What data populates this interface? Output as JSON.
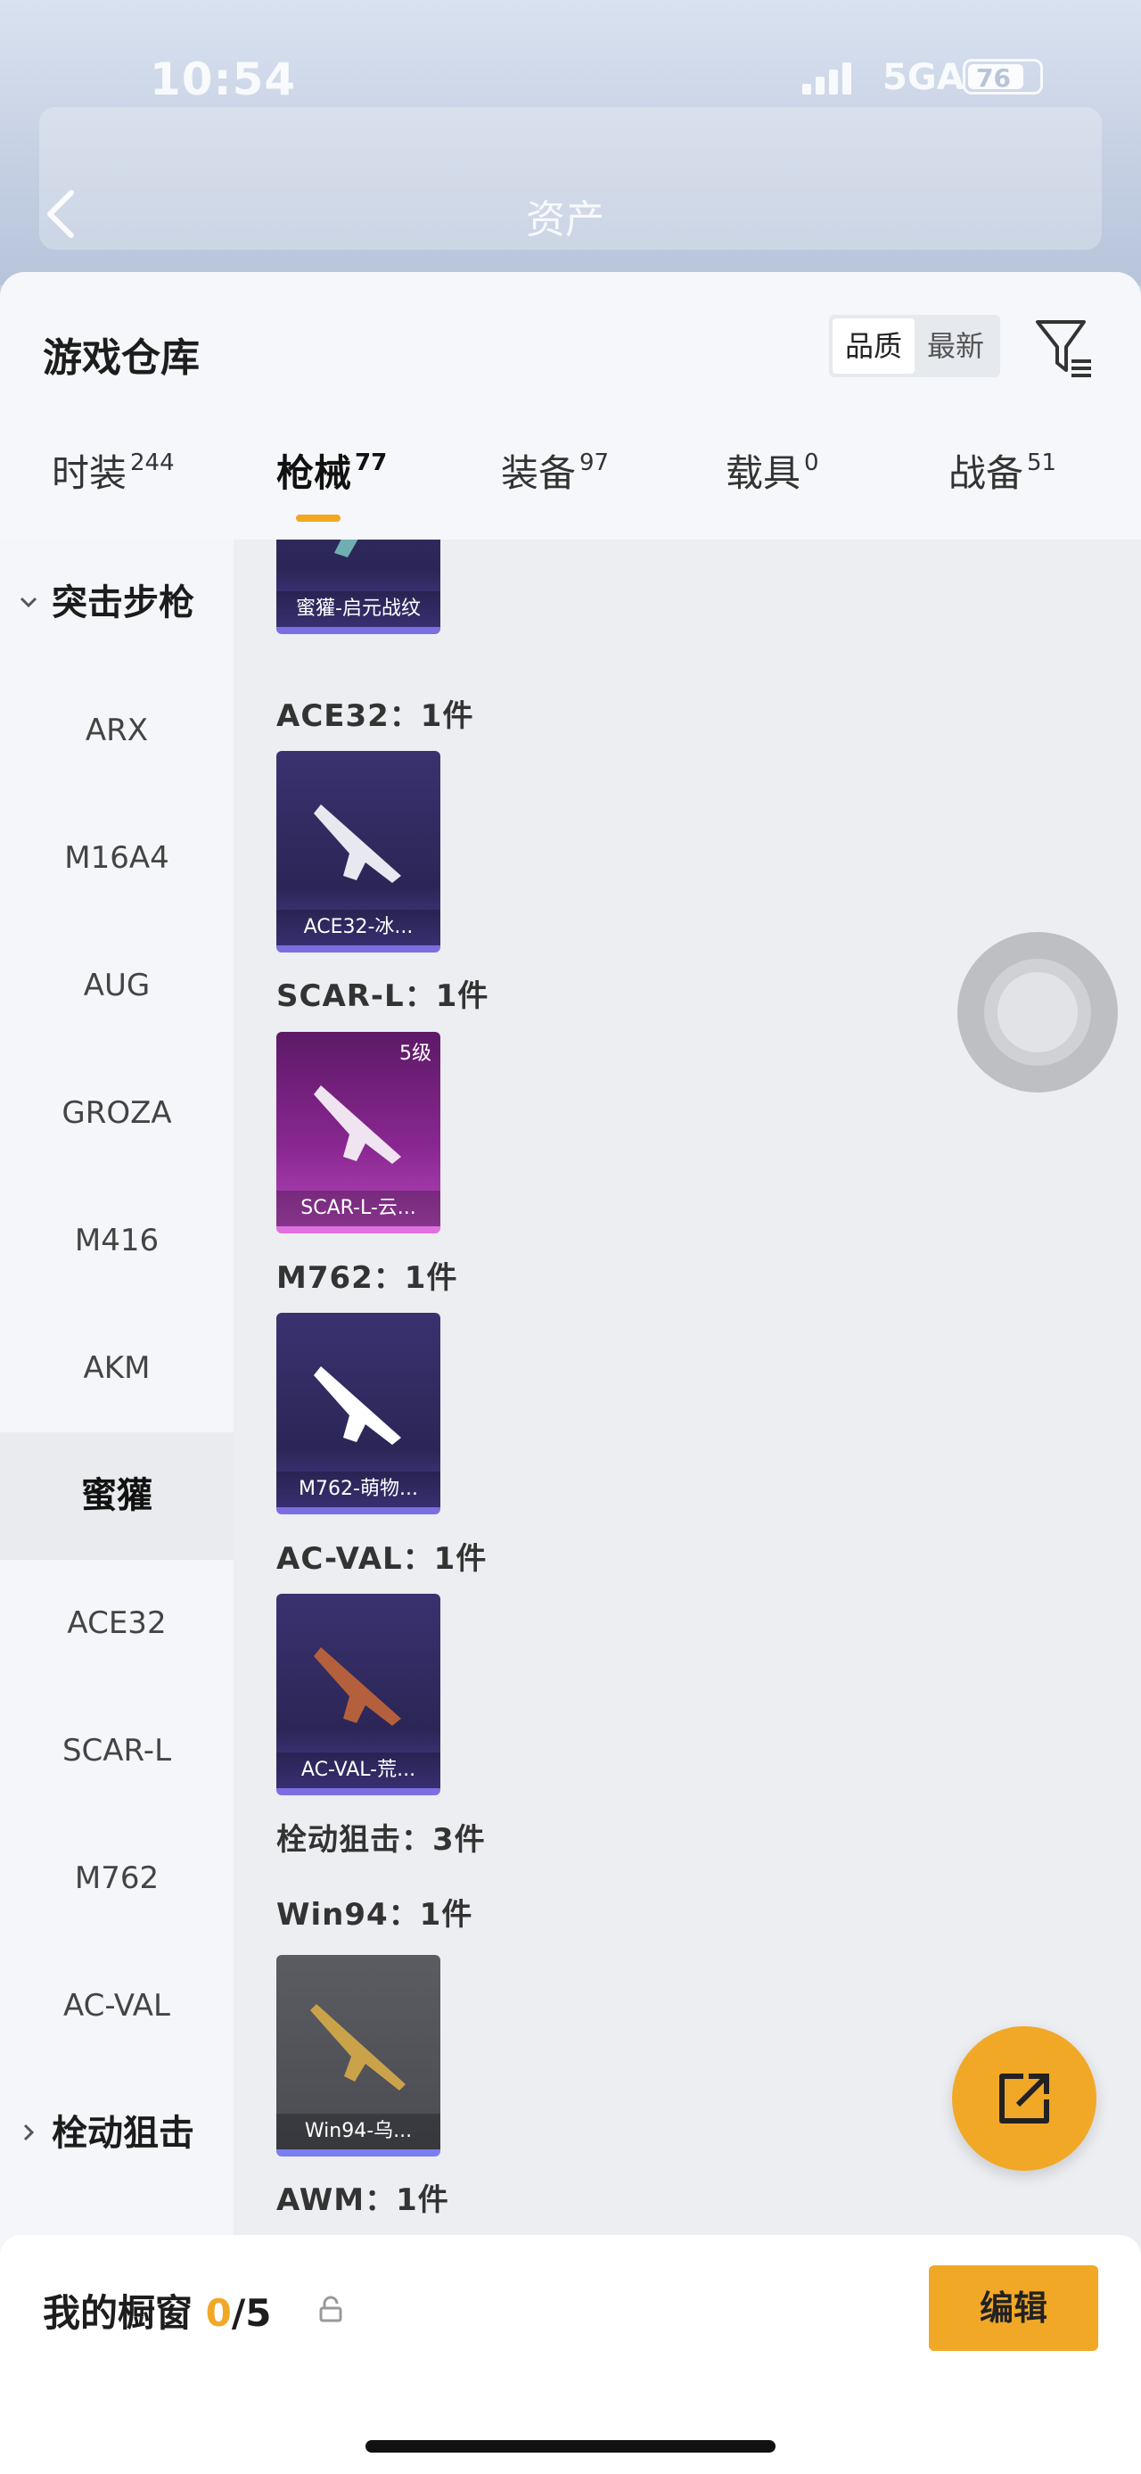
{
  "status_bar": {
    "time": "10:54",
    "network": "5GA",
    "battery": "76"
  },
  "nav": {
    "title": "资产"
  },
  "header": {
    "title": "游戏仓库",
    "sort_options": [
      "品质",
      "最新"
    ],
    "active_sort": "品质"
  },
  "tabs": [
    {
      "label": "时装",
      "count": "244"
    },
    {
      "label": "枪械",
      "count": "77"
    },
    {
      "label": "装备",
      "count": "97"
    },
    {
      "label": "载具",
      "count": "0"
    },
    {
      "label": "战备",
      "count": "51"
    }
  ],
  "sidebar": {
    "group_expanded": "突击步枪",
    "items": [
      "ARX",
      "M16A4",
      "AUG",
      "GROZA",
      "M416",
      "AKM",
      "蜜獾",
      "ACE32",
      "SCAR-L",
      "M762",
      "AC-VAL"
    ],
    "selected": "蜜獾",
    "group_collapsed": "栓动狙击"
  },
  "content": {
    "cards": [
      {
        "label": "蜜獾-启元战纹",
        "tier": "",
        "style": "purple"
      },
      {
        "label": "ACE32-冰...",
        "tier": "",
        "style": "purple"
      },
      {
        "label": "SCAR-L-云...",
        "tier": "5级",
        "style": "pink"
      },
      {
        "label": "M762-萌物...",
        "tier": "",
        "style": "purple"
      },
      {
        "label": "AC-VAL-荒...",
        "tier": "",
        "style": "purple"
      },
      {
        "label": "Win94-乌...",
        "tier": "",
        "style": "grey"
      }
    ],
    "group_labels": [
      "ACE32：1件",
      "SCAR-L：1件",
      "M762：1件",
      "AC-VAL：1件",
      "栓动狙击：3件",
      "Win94：1件",
      "AWM：1件"
    ]
  },
  "showcase": {
    "label": "我的橱窗",
    "count": "0",
    "total": "/5",
    "edit_label": "编辑"
  },
  "colors": {
    "accent": "#f2a827",
    "sheet_bg": "#f1f3f6"
  },
  "icons": [
    "back-icon",
    "filter-icon",
    "caret-down-icon",
    "caret-right-icon",
    "share-icon",
    "lock-icon"
  ]
}
